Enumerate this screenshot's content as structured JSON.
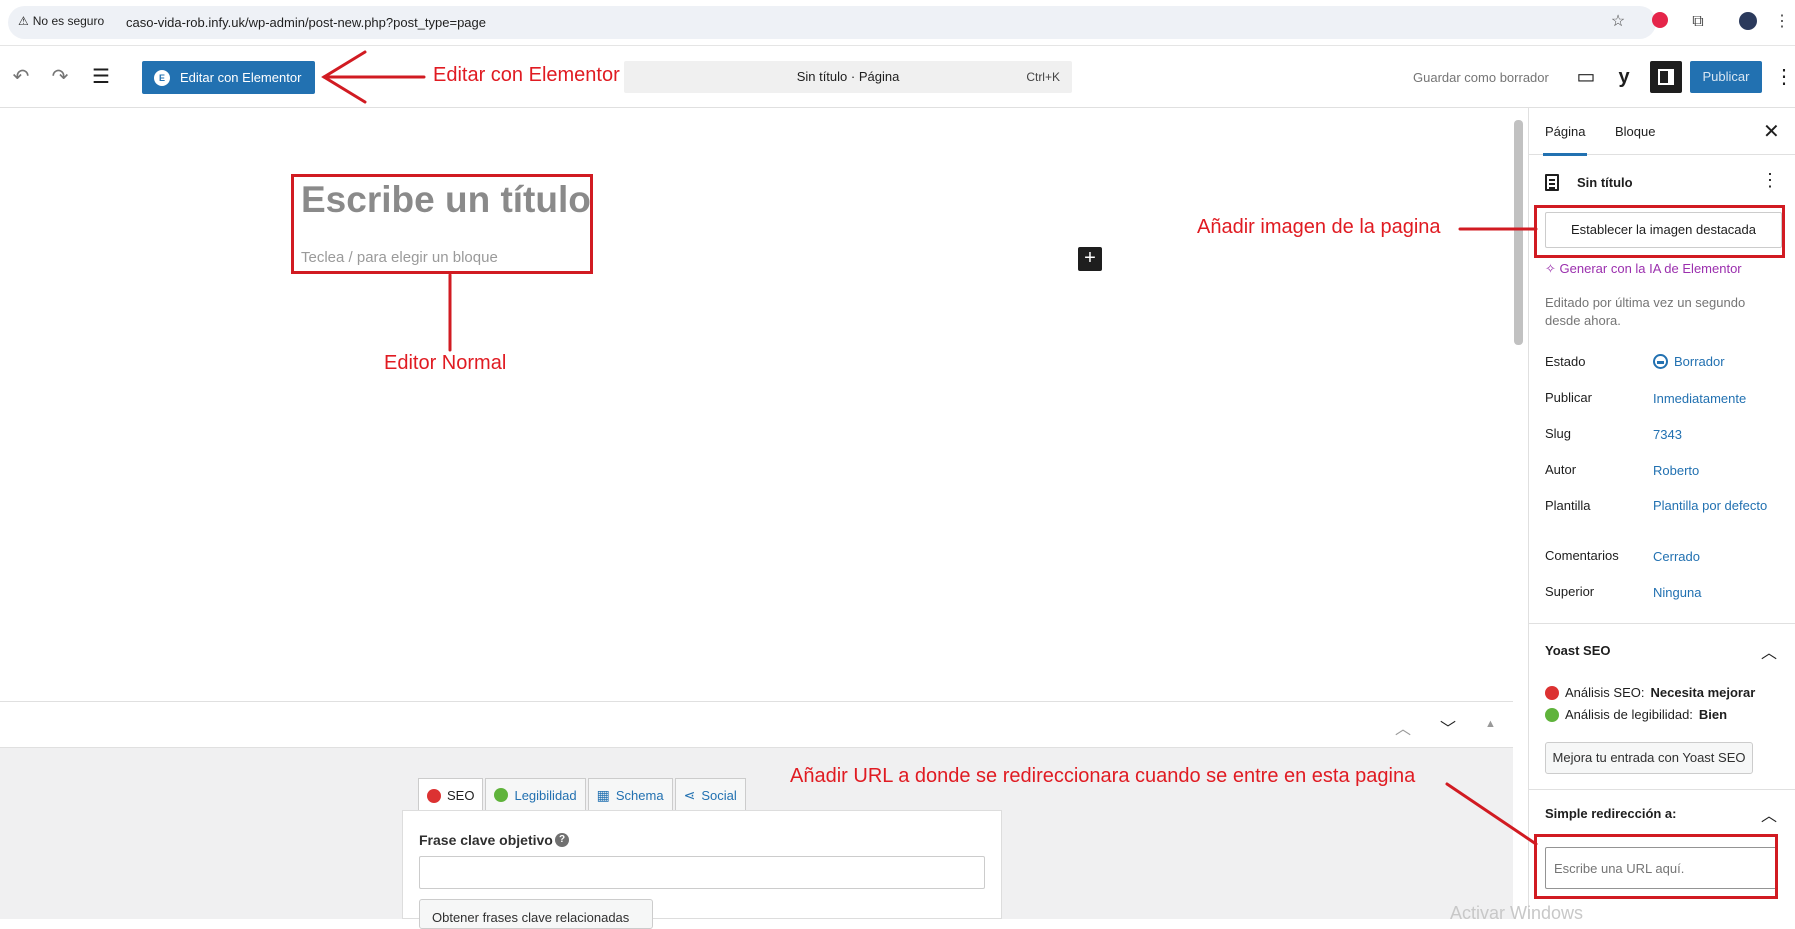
{
  "browser": {
    "security_label": "No es seguro",
    "url": "caso-vida-rob.infy.uk/wp-admin/post-new.php?post_type=page"
  },
  "toolbar": {
    "elementor_label": "Editar con Elementor",
    "command_title": "Sin título · Página",
    "command_shortcut": "Ctrl+K",
    "save_draft_label": "Guardar como borrador",
    "publish_label": "Publicar"
  },
  "canvas": {
    "title_placeholder": "Escribe un título",
    "block_placeholder": "Teclea / para elegir un bloque",
    "inserter_symbol": "+"
  },
  "yoast_metabox": {
    "tabs": [
      {
        "label": "SEO",
        "color": "#dc3232"
      },
      {
        "label": "Legibilidad",
        "color": "#7ad03a"
      },
      {
        "label": "Schema"
      },
      {
        "label": "Social"
      }
    ],
    "keyphrase_label": "Frase clave objetivo",
    "help_symbol": "?",
    "related_button": "Obtener frases clave relacionadas"
  },
  "sidebar": {
    "tabs": [
      "Página",
      "Bloque"
    ],
    "doc_title": "Sin título",
    "featured_image_button": "Establecer la imagen destacada",
    "generate_ai_label": "Generar con la IA de Elementor",
    "edited_text": "Editado por última vez un segundo desde ahora.",
    "rows": [
      {
        "label": "Estado",
        "value": "Borrador"
      },
      {
        "label": "Publicar",
        "value": "Inmediatamente"
      },
      {
        "label": "Slug",
        "value": "7343"
      },
      {
        "label": "Autor",
        "value": "Roberto"
      },
      {
        "label": "Plantilla",
        "value": "Plantilla por defecto"
      },
      {
        "label": "Comentarios",
        "value": "Cerrado"
      },
      {
        "label": "Superior",
        "value": "Ninguna"
      }
    ],
    "yoast": {
      "title": "Yoast SEO",
      "seo_label": "Análisis SEO:",
      "seo_value": "Necesita mejorar",
      "read_label": "Análisis de legibilidad:",
      "read_value": "Bien",
      "improve_button": "Mejora tu entrada con Yoast SEO",
      "bad_color": "#dc3232",
      "good_color": "#7ad03a"
    },
    "redirect": {
      "title": "Simple redirección a:",
      "placeholder": "Escribe una URL aquí."
    }
  },
  "watermark": "Activar Windows",
  "annotations": {
    "elementor": "Editar con Elementor",
    "normal": "Editor Normal",
    "featured": "Añadir imagen de la pagina",
    "redirect": "Añadir URL a donde se redireccionara cuando se entre en esta pagina",
    "color": "#e01b22"
  }
}
